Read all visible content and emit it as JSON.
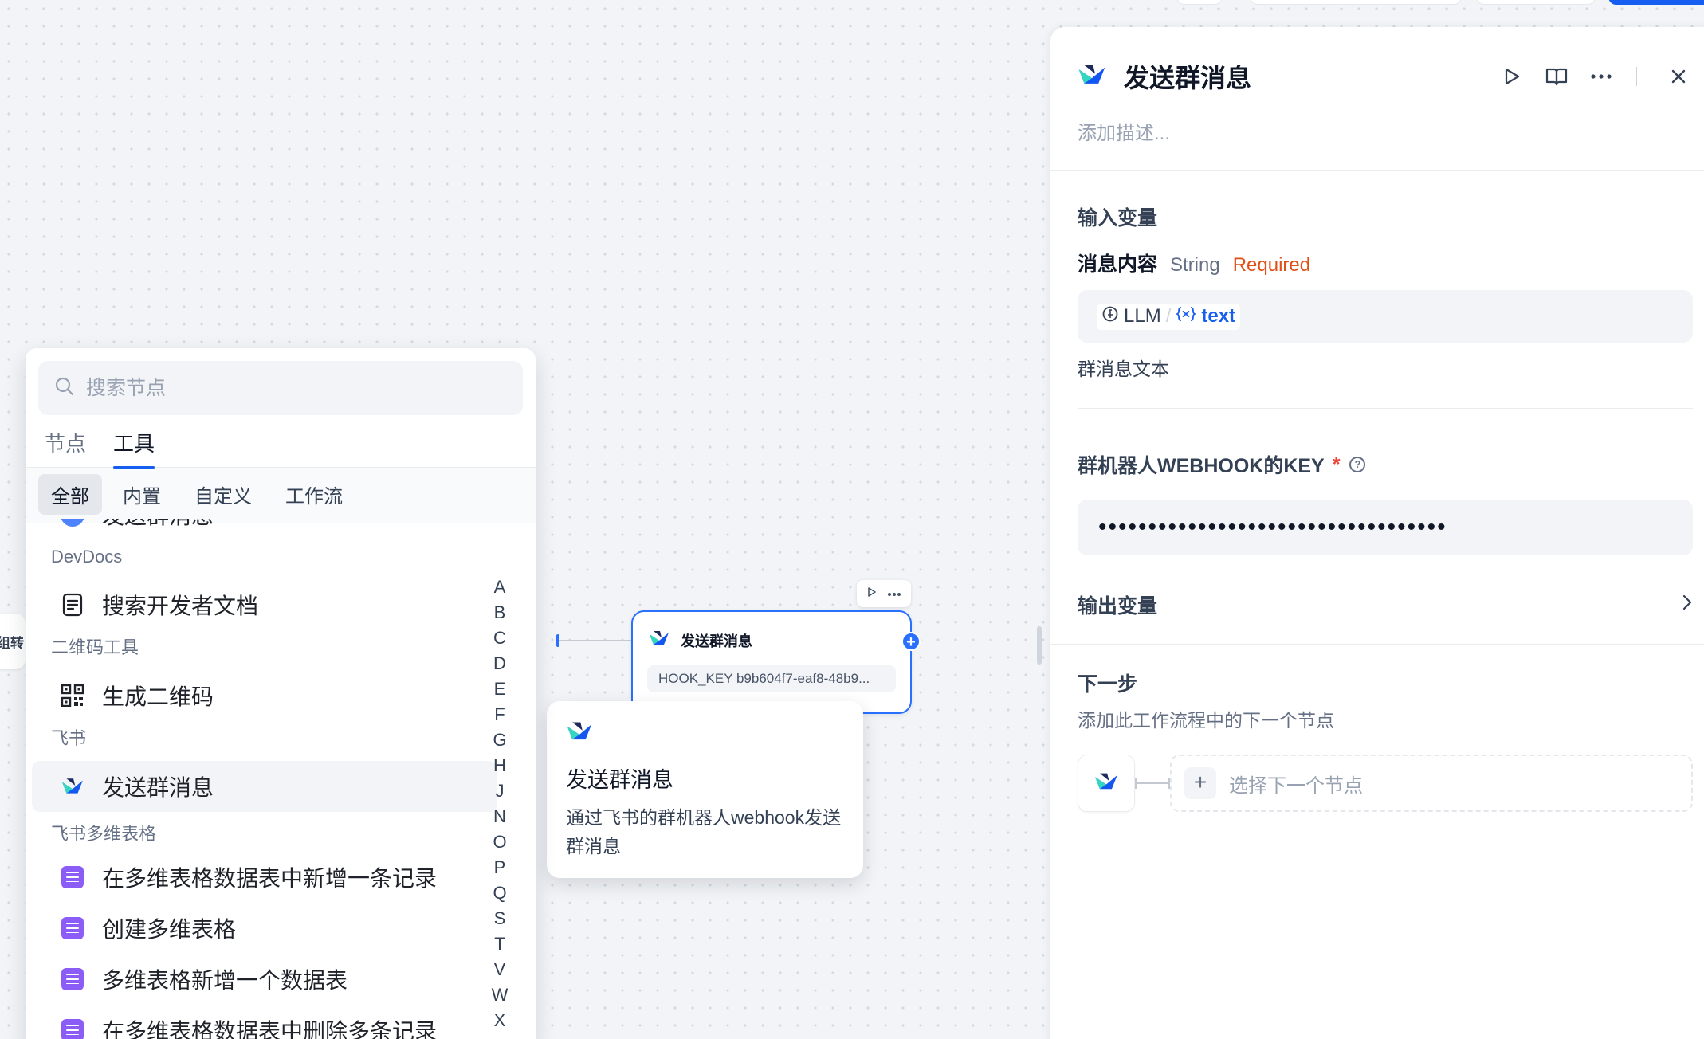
{
  "colors": {
    "accent": "#155eef",
    "required": "#e04f16",
    "star": "#f04438",
    "bitable": "#8b5cf6"
  },
  "edge_node": {
    "label": "组转"
  },
  "canvas_node": {
    "title": "发送群消息",
    "param_text": "HOOK_KEY b9b604f7-eaf8-48b9..."
  },
  "tooltip": {
    "title": "发送群消息",
    "description": "通过飞书的群机器人webhook发送群消息"
  },
  "picker": {
    "search_placeholder": "搜索节点",
    "tabs": [
      {
        "label": "节点",
        "active": false
      },
      {
        "label": "工具",
        "active": true
      }
    ],
    "subtabs": [
      {
        "label": "全部",
        "active": true
      },
      {
        "label": "内置",
        "active": false
      },
      {
        "label": "自定义",
        "active": false
      },
      {
        "label": "工作流",
        "active": false
      }
    ],
    "top_partial_item": "发送群消息",
    "groups": [
      {
        "name": "DevDocs",
        "items": [
          {
            "label": "搜索开发者文档",
            "icon": "document-icon"
          }
        ]
      },
      {
        "name": "二维码工具",
        "items": [
          {
            "label": "生成二维码",
            "icon": "qrcode-icon"
          }
        ]
      },
      {
        "name": "飞书",
        "items": [
          {
            "label": "发送群消息",
            "icon": "feishu-icon"
          }
        ]
      },
      {
        "name": "飞书多维表格",
        "items": [
          {
            "label": "在多维表格数据表中新增一条记录",
            "icon": "bitable-icon"
          },
          {
            "label": "创建多维表格",
            "icon": "bitable-icon"
          },
          {
            "label": "多维表格新增一个数据表",
            "icon": "bitable-icon"
          },
          {
            "label": "在多维表格数据表中删除多条记录",
            "icon": "bitable-icon"
          }
        ]
      }
    ],
    "alphabet": [
      "A",
      "B",
      "C",
      "D",
      "E",
      "F",
      "G",
      "H",
      "J",
      "N",
      "O",
      "P",
      "Q",
      "S",
      "T",
      "V",
      "W",
      "X"
    ]
  },
  "inspector": {
    "title": "发送群消息",
    "description_placeholder": "添加描述...",
    "input_section_title": "输入变量",
    "message_var": {
      "name": "消息内容",
      "type": "String",
      "required_label": "Required",
      "source_node": "LLM",
      "source_var": "text",
      "help": "群消息文本"
    },
    "webhook_key": {
      "label": "群机器人WEBHOOK的KEY",
      "required_mark": "*",
      "value": "•••••••••••••••••••••••••••••••••••"
    },
    "output_section_title": "输出变量",
    "next_step": {
      "title": "下一步",
      "subtitle": "添加此工作流程中的下一个节点",
      "select_label": "选择下一个节点"
    }
  }
}
